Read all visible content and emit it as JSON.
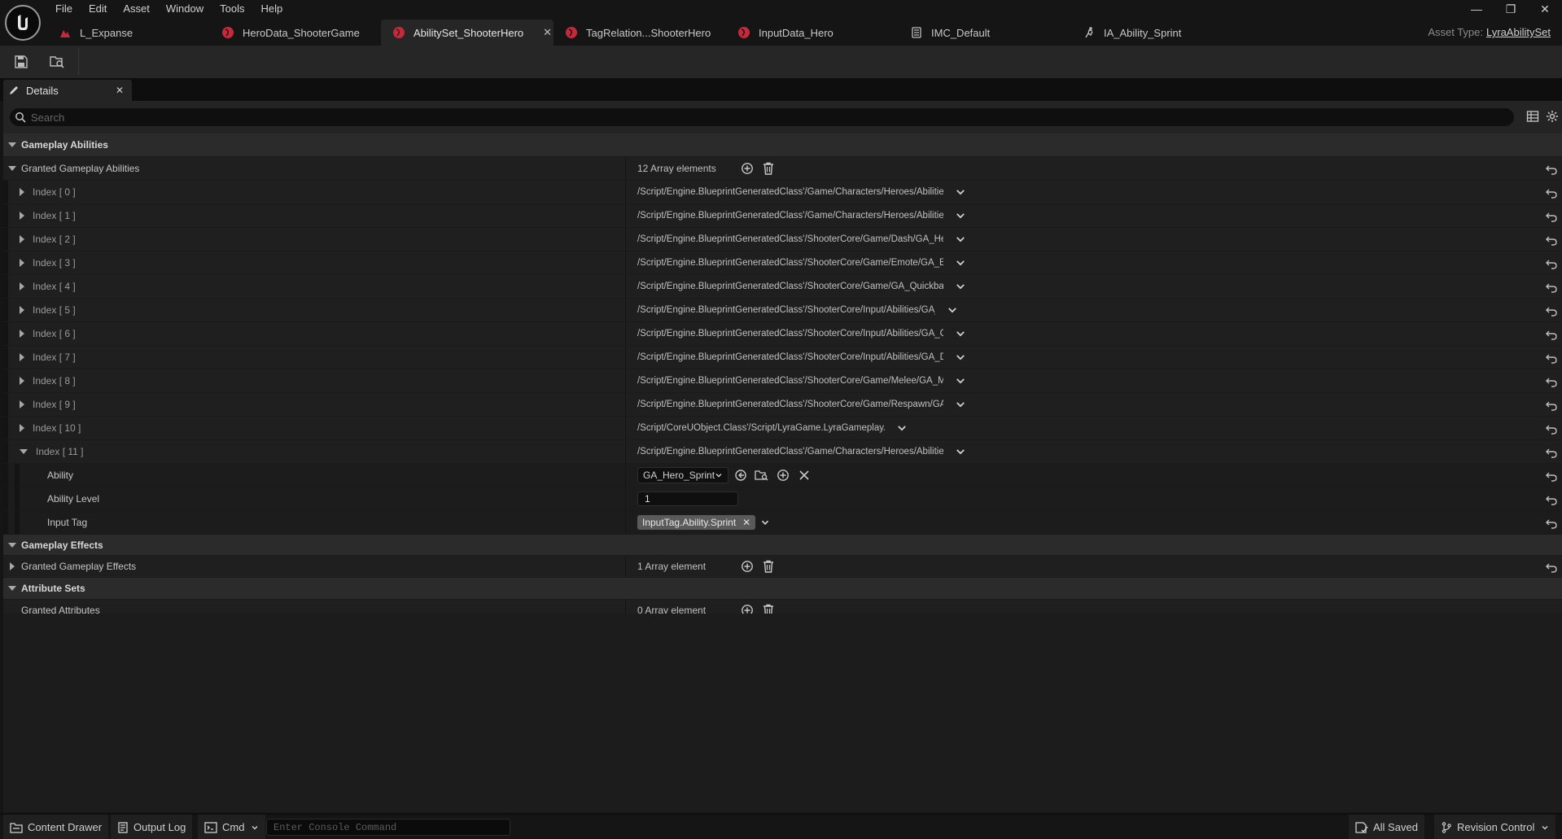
{
  "menu": [
    "File",
    "Edit",
    "Asset",
    "Window",
    "Tools",
    "Help"
  ],
  "tabs": [
    {
      "label": "L_Expanse",
      "icon": "level-icon",
      "active": false
    },
    {
      "label": "HeroData_ShooterGame",
      "icon": "data-asset-icon",
      "active": false
    },
    {
      "label": "AbilitySet_ShooterHero",
      "icon": "data-asset-icon",
      "active": true
    },
    {
      "label": "TagRelation...ShooterHero",
      "icon": "data-asset-icon",
      "active": false
    },
    {
      "label": "InputData_Hero",
      "icon": "data-asset-icon",
      "active": false
    },
    {
      "label": "IMC_Default",
      "icon": "input-mapping-icon",
      "active": false
    },
    {
      "label": "IA_Ability_Sprint",
      "icon": "input-action-icon",
      "active": false
    }
  ],
  "asset_type": {
    "label": "Asset Type:",
    "value": "LyraAbilitySet"
  },
  "details": {
    "tab_label": "Details",
    "search_placeholder": "Search"
  },
  "gameplay_abilities": {
    "category": "Gameplay Abilities",
    "granted": {
      "label": "Granted Gameplay Abilities",
      "count": "12 Array elements",
      "items": [
        {
          "index": "Index [ 0 ]",
          "value": "/Script/Engine.BlueprintGeneratedClass'/Game/Characters/Heroes/Abilities/GA_Hero_Jum"
        },
        {
          "index": "Index [ 1 ]",
          "value": "/Script/Engine.BlueprintGeneratedClass'/Game/Characters/Heroes/Abilities/GA_Hero_Deat"
        },
        {
          "index": "Index [ 2 ]",
          "value": "/Script/Engine.BlueprintGeneratedClass'/ShooterCore/Game/Dash/GA_Hero_Dash.GA_Hero_"
        },
        {
          "index": "Index [ 3 ]",
          "value": "/Script/Engine.BlueprintGeneratedClass'/ShooterCore/Game/Emote/GA_Emote.GA_Emote_("
        },
        {
          "index": "Index [ 4 ]",
          "value": "/Script/Engine.BlueprintGeneratedClass'/ShooterCore/Game/GA_QuickbarSlots.GA_Quickba"
        },
        {
          "index": "Index [ 5 ]",
          "value": "/Script/Engine.BlueprintGeneratedClass'/ShooterCore/Input/Abilities/GA_ADS.GA_ADS_C'"
        },
        {
          "index": "Index [ 6 ]",
          "value": "/Script/Engine.BlueprintGeneratedClass'/ShooterCore/Input/Abilities/GA_Grenade.GA_Grena"
        },
        {
          "index": "Index [ 7 ]",
          "value": "/Script/Engine.BlueprintGeneratedClass'/ShooterCore/Input/Abilities/GA_DropWeapon.GA_D"
        },
        {
          "index": "Index [ 8 ]",
          "value": "/Script/Engine.BlueprintGeneratedClass'/ShooterCore/Game/Melee/GA_Melee.GA_Melee_C"
        },
        {
          "index": "Index [ 9 ]",
          "value": "/Script/Engine.BlueprintGeneratedClass'/ShooterCore/Game/Respawn/GA_SpawnEffect.GA_"
        },
        {
          "index": "Index [ 10 ]",
          "value": "/Script/CoreUObject.Class'/Script/LyraGame.LyraGameplayAbility_Reset'"
        },
        {
          "index": "Index [ 11 ]",
          "value": "/Script/Engine.BlueprintGeneratedClass'/Game/Characters/Heroes/Abilities/GA_Hero_Sprir"
        }
      ],
      "expanded": {
        "ability_label": "Ability",
        "ability_value": "GA_Hero_Sprint",
        "level_label": "Ability Level",
        "level_value": "1",
        "tag_label": "Input Tag",
        "tag_value": "InputTag.Ability.Sprint"
      }
    }
  },
  "gameplay_effects": {
    "category": "Gameplay Effects",
    "label": "Granted Gameplay Effects",
    "count": "1 Array element"
  },
  "attribute_sets": {
    "category": "Attribute Sets",
    "label": "Granted Attributes",
    "count": "0 Array element"
  },
  "statusbar": {
    "content_drawer": "Content Drawer",
    "output_log": "Output Log",
    "cmd": "Cmd",
    "console_placeholder": "Enter Console Command",
    "all_saved": "All Saved",
    "revision_control": "Revision Control"
  },
  "colors": {
    "accent_red": "#c8283c",
    "bg": "#151515",
    "panel": "#242424"
  }
}
